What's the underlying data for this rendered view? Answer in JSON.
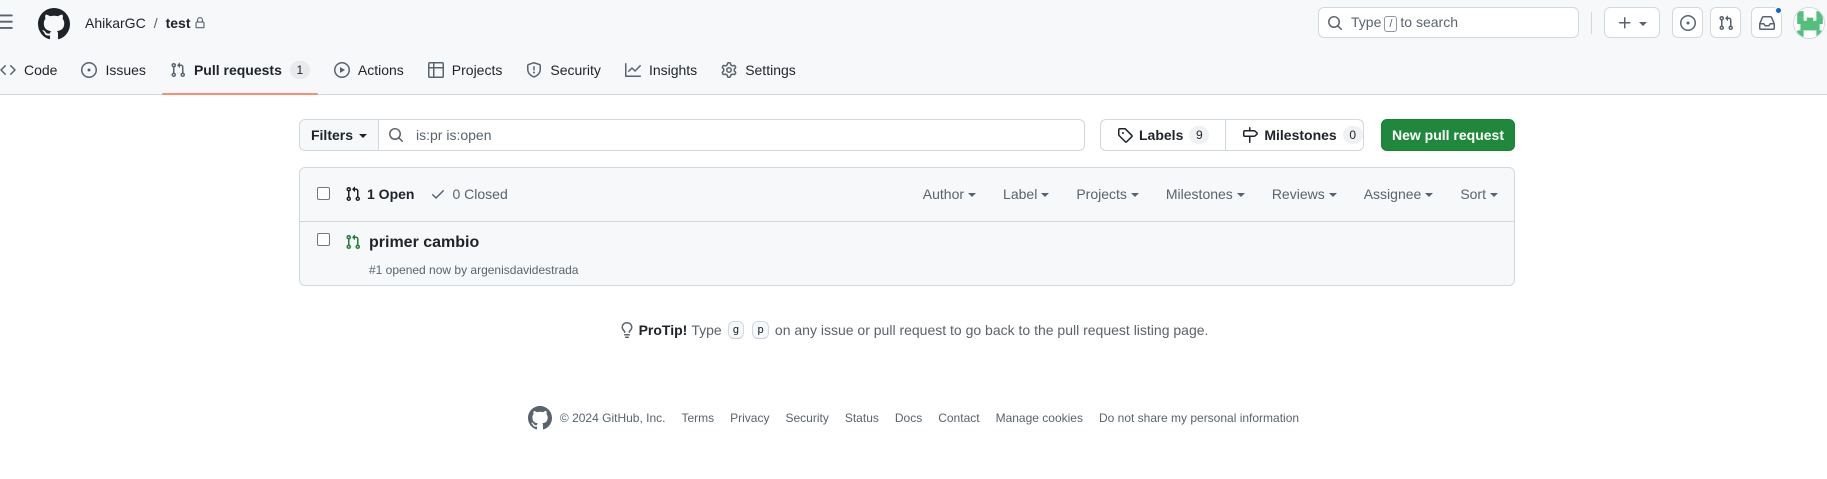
{
  "header": {
    "owner": "AhikarGC",
    "separator": "/",
    "repo": "test",
    "search_type": "Type",
    "search_slash": "/",
    "search_to": "to search"
  },
  "tabs": [
    {
      "label": "Code",
      "icon": "code-icon"
    },
    {
      "label": "Issues",
      "icon": "issue-opened-icon"
    },
    {
      "label": "Pull requests",
      "icon": "git-pull-request-icon",
      "count": "1",
      "selected": true
    },
    {
      "label": "Actions",
      "icon": "play-icon"
    },
    {
      "label": "Projects",
      "icon": "table-icon"
    },
    {
      "label": "Security",
      "icon": "shield-icon"
    },
    {
      "label": "Insights",
      "icon": "graph-icon"
    },
    {
      "label": "Settings",
      "icon": "gear-icon"
    }
  ],
  "toolbar": {
    "filters_label": "Filters",
    "filter_value": "is:pr is:open",
    "labels_label": "Labels",
    "labels_count": "9",
    "milestones_label": "Milestones",
    "milestones_count": "0",
    "new_pr_label": "New pull request"
  },
  "list": {
    "open_label": "1 Open",
    "closed_label": "0 Closed",
    "menus": [
      "Author",
      "Label",
      "Projects",
      "Milestones",
      "Reviews",
      "Assignee",
      "Sort"
    ],
    "items": [
      {
        "title": "primer cambio",
        "meta": "#1 opened now by argenisdavidestrada"
      }
    ]
  },
  "protip": {
    "label": "ProTip!",
    "pre": "Type",
    "key1": "g",
    "key2": "p",
    "post": "on any issue or pull request to go back to the pull request listing page."
  },
  "footer": {
    "copyright": "© 2024 GitHub, Inc.",
    "links": [
      "Terms",
      "Privacy",
      "Security",
      "Status",
      "Docs",
      "Contact",
      "Manage cookies",
      "Do not share my personal information"
    ]
  },
  "colors": {
    "accent_green": "#1f883d",
    "tab_underline": "#fd8c73",
    "notification_blue": "#0969da"
  }
}
